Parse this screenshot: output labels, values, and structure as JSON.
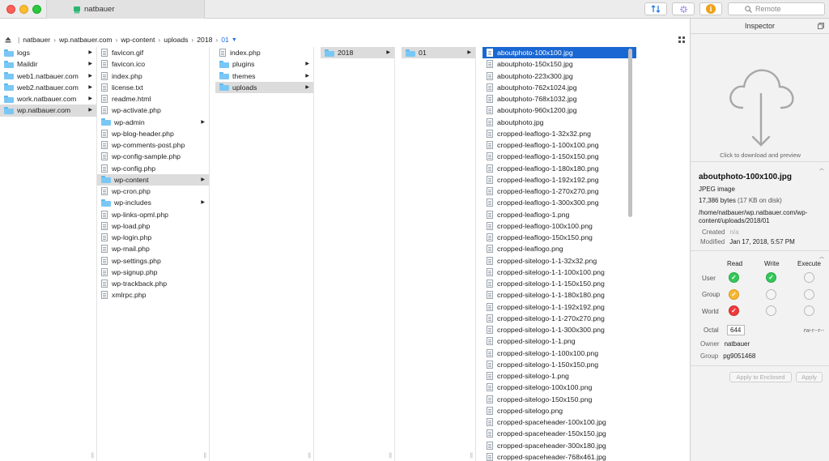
{
  "window": {
    "tab_title": "natbauer"
  },
  "toolbar": {
    "remote_label": "Remote"
  },
  "path": {
    "crumbs": [
      "natbauer",
      "wp.natbauer.com",
      "wp-content",
      "uploads",
      "2018",
      "01"
    ]
  },
  "columns": {
    "col1": [
      {
        "name": "logs",
        "type": "folder"
      },
      {
        "name": "Maildir",
        "type": "folder"
      },
      {
        "name": "web1.natbauer.com",
        "type": "folder"
      },
      {
        "name": "web2.natbauer.com",
        "type": "folder"
      },
      {
        "name": "work.natbauer.com",
        "type": "folder"
      },
      {
        "name": "wp.natbauer.com",
        "type": "folder"
      }
    ],
    "col2": [
      "favicon.gif",
      "favicon.ico",
      "index.php",
      "license.txt",
      "readme.html",
      "wp-activate.php",
      "wp-admin",
      "wp-blog-header.php",
      "wp-comments-post.php",
      "wp-config-sample.php",
      "wp-config.php",
      "wp-content",
      "wp-cron.php",
      "wp-includes",
      "wp-links-opml.php",
      "wp-load.php",
      "wp-login.php",
      "wp-mail.php",
      "wp-settings.php",
      "wp-signup.php",
      "wp-trackback.php",
      "xmlrpc.php"
    ],
    "col3": [
      "index.php",
      "plugins",
      "themes",
      "uploads"
    ],
    "col4": [
      "2018"
    ],
    "col5": [
      "01"
    ],
    "col6": [
      "aboutphoto-100x100.jpg",
      "aboutphoto-150x150.jpg",
      "aboutphoto-223x300.jpg",
      "aboutphoto-762x1024.jpg",
      "aboutphoto-768x1032.jpg",
      "aboutphoto-960x1200.jpg",
      "aboutphoto.jpg",
      "cropped-leaflogo-1-32x32.png",
      "cropped-leaflogo-1-100x100.png",
      "cropped-leaflogo-1-150x150.png",
      "cropped-leaflogo-1-180x180.png",
      "cropped-leaflogo-1-192x192.png",
      "cropped-leaflogo-1-270x270.png",
      "cropped-leaflogo-1-300x300.png",
      "cropped-leaflogo-1.png",
      "cropped-leaflogo-100x100.png",
      "cropped-leaflogo-150x150.png",
      "cropped-leaflogo.png",
      "cropped-sitelogo-1-1-32x32.png",
      "cropped-sitelogo-1-1-100x100.png",
      "cropped-sitelogo-1-1-150x150.png",
      "cropped-sitelogo-1-1-180x180.png",
      "cropped-sitelogo-1-1-192x192.png",
      "cropped-sitelogo-1-1-270x270.png",
      "cropped-sitelogo-1-1-300x300.png",
      "cropped-sitelogo-1-1.png",
      "cropped-sitelogo-1-100x100.png",
      "cropped-sitelogo-1-150x150.png",
      "cropped-sitelogo-1.png",
      "cropped-sitelogo-100x100.png",
      "cropped-sitelogo-150x150.png",
      "cropped-sitelogo.png",
      "cropped-spaceheader-100x100.jpg",
      "cropped-spaceheader-150x150.jpg",
      "cropped-spaceheader-300x180.jpg",
      "cropped-spaceheader-768x461.jpg"
    ]
  },
  "inspector": {
    "title": "Inspector",
    "click_download": "Click to download and preview",
    "file_name": "aboutphoto-100x100.jpg",
    "file_type": "JPEG image",
    "size_bytes": "17,386 bytes",
    "size_disk": "(17 KB on disk)",
    "path": "/home/natbauer/wp.natbauer.com/wp-content/uploads/2018/01",
    "created_label": "Created",
    "created_value": "n/a",
    "modified_label": "Modified",
    "modified_value": "Jan 17, 2018, 5:57 PM",
    "perm_headers": {
      "read": "Read",
      "write": "Write",
      "execute": "Execute"
    },
    "perm_rows": {
      "user": "User",
      "group": "Group",
      "world": "World"
    },
    "octal_label": "Octal",
    "octal_value": "644",
    "perm_string": "rw-r--r--",
    "owner_label": "Owner",
    "owner_value": "natbauer",
    "group_label": "Group",
    "group_value": "pg9051468",
    "apply_enclosed": "Apply to Enclosed",
    "apply": "Apply"
  }
}
